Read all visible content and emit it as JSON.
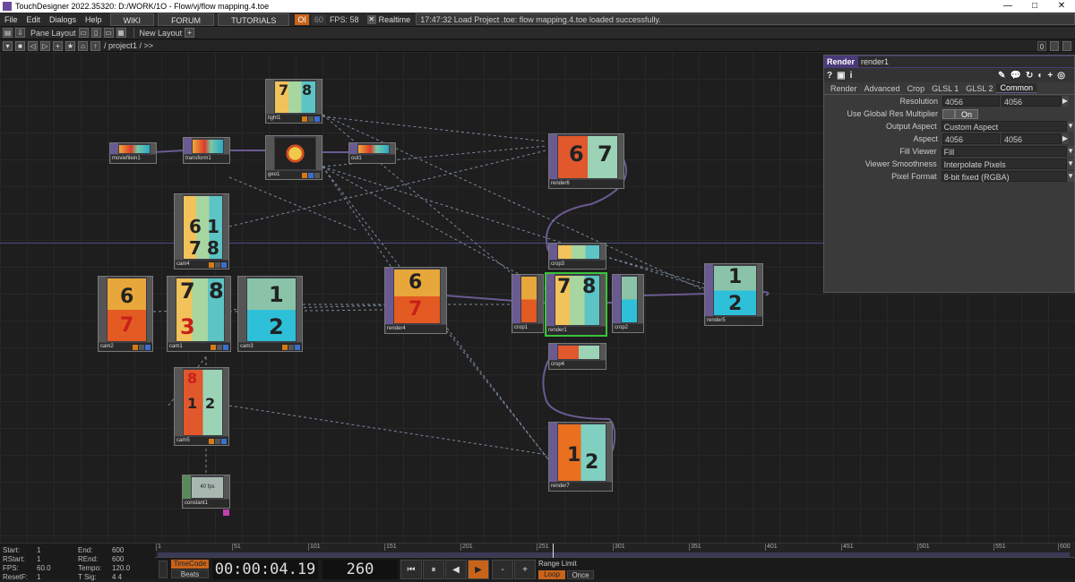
{
  "window": {
    "title": "TouchDesigner 2022.35320: D:/WORK/1O - Flow/vj/flow mapping.4.toe",
    "minimize": "—",
    "maximize": "□",
    "close": "✕"
  },
  "menu": {
    "items": [
      "File",
      "Edit",
      "Dialogs",
      "Help"
    ],
    "links": [
      "WIKI",
      "FORUM",
      "TUTORIALS"
    ],
    "oi": "OI",
    "fps_target": "60",
    "fps_label": "FPS:",
    "fps_value": "58",
    "realtime": "Realtime",
    "status": "17:47:32 Load Project .toe: flow mapping.4.toe loaded successfully."
  },
  "toolbar": {
    "pane_layout": "Pane Layout",
    "new_layout": "New Layout",
    "add": "+"
  },
  "path": {
    "text": "/ project1 / >>",
    "right_num": "0"
  },
  "nodes": [
    {
      "id": "light1",
      "label": "light1"
    },
    {
      "id": "moviefilein1",
      "label": "moviefilein1"
    },
    {
      "id": "transform1",
      "label": "transform1"
    },
    {
      "id": "geo1",
      "label": "geo1"
    },
    {
      "id": "out1",
      "label": "out1"
    },
    {
      "id": "render6",
      "label": "render6"
    },
    {
      "id": "cam4",
      "label": "cam4"
    },
    {
      "id": "cam2",
      "label": "cam2"
    },
    {
      "id": "cam1",
      "label": "cam1"
    },
    {
      "id": "cam3",
      "label": "cam3"
    },
    {
      "id": "render4",
      "label": "render4"
    },
    {
      "id": "crop3",
      "label": "crop3"
    },
    {
      "id": "crop1",
      "label": "crop1"
    },
    {
      "id": "render1",
      "label": "render1"
    },
    {
      "id": "crop2",
      "label": "crop2"
    },
    {
      "id": "render5",
      "label": "render5"
    },
    {
      "id": "crop4",
      "label": "crop4"
    },
    {
      "id": "cam5",
      "label": "cam5"
    },
    {
      "id": "render7",
      "label": "render7"
    },
    {
      "id": "constant1",
      "label": "constant1"
    }
  ],
  "digits": {
    "d1": "7",
    "d2": "8",
    "d3": "6",
    "d4": "7",
    "d5": "6",
    "d6": "1",
    "d7": "7",
    "d8": "8",
    "d9": "6",
    "d10": "7",
    "d11": "7",
    "d12": "8",
    "d13": "3",
    "d14": "1",
    "d15": "2",
    "d16": "6",
    "d17": "7",
    "d18": "7",
    "d19": "8",
    "d20": "1",
    "d21": "2",
    "d22": "8",
    "d23": "1",
    "d24": "2",
    "d25": "1",
    "d26": "2"
  },
  "constant_text": "40 fps",
  "panel": {
    "type": "Render",
    "name": "render1",
    "icons": [
      "?",
      "▣",
      "i"
    ],
    "tabs": [
      "Render",
      "Advanced",
      "Crop",
      "GLSL 1",
      "GLSL 2",
      "Common"
    ],
    "active_tab": "Common",
    "params": {
      "resolution_label": "Resolution",
      "resolution_w": "4056",
      "resolution_h": "4056",
      "global_res_label": "Use Global Res Multiplier",
      "global_res_value": "On",
      "output_aspect_label": "Output Aspect",
      "output_aspect_value": "Custom Aspect",
      "aspect_label": "Aspect",
      "aspect_w": "4056",
      "aspect_h": "4056",
      "fill_viewer_label": "Fill Viewer",
      "fill_viewer_value": "Fill",
      "viewer_smooth_label": "Viewer Smoothness",
      "viewer_smooth_value": "Interpolate Pixels",
      "pixel_format_label": "Pixel Format",
      "pixel_format_value": "8-bit fixed (RGBA)"
    }
  },
  "timeline": {
    "start_label": "Start:",
    "start": "1",
    "end_label": "End:",
    "end": "600",
    "rstart_label": "RStart:",
    "rstart": "1",
    "rend_label": "REnd:",
    "rend": "600",
    "fps_label": "FPS:",
    "fps": "60.0",
    "tempo_label": "Tempo:",
    "tempo": "120.0",
    "resetf_label": "ResetF:",
    "resetf": "1",
    "tsig_label": "T Sig:",
    "tsig": "4    4",
    "ticks": [
      "1",
      "51",
      "101",
      "151",
      "201",
      "251",
      "301",
      "351",
      "401",
      "451",
      "501",
      "551",
      "600"
    ],
    "timecode_btn": "TimeCode",
    "beats_btn": "Beats",
    "timecode": "00:00:04.19",
    "frame": "260",
    "controls": [
      "⏮",
      "⏸",
      "◀",
      "▶",
      "-",
      "+"
    ],
    "range_limit": "Range Limit",
    "loop": "Loop",
    "once": "Once"
  }
}
